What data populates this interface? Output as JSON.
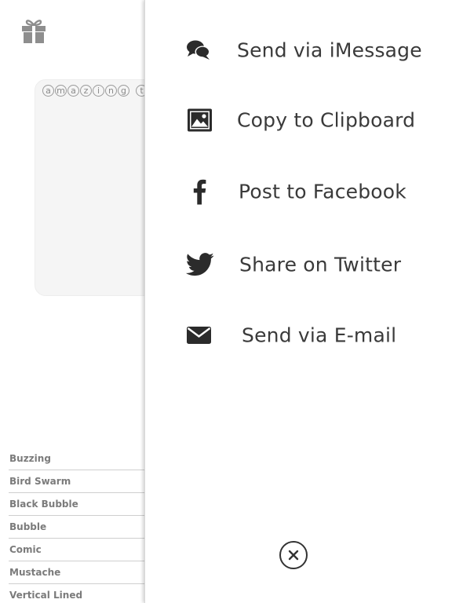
{
  "background": {
    "gift_icon": "gift-icon",
    "preview_chars": [
      "a",
      "m",
      "a",
      "z",
      "i",
      "n",
      "g",
      "t"
    ],
    "style_list": [
      {
        "label": "Buzzing"
      },
      {
        "label": "Bird Swarm"
      },
      {
        "label": "Black Bubble"
      },
      {
        "label": "Bubble"
      },
      {
        "label": "Comic"
      },
      {
        "label": "Mustache"
      },
      {
        "label": "Vertical Lined"
      }
    ]
  },
  "share_sheet": {
    "options": [
      {
        "label": "Send via iMessage",
        "icon": "chat-bubbles-icon"
      },
      {
        "label": "Copy to Clipboard",
        "icon": "image-icon"
      },
      {
        "label": "Post to Facebook",
        "icon": "facebook-icon"
      },
      {
        "label": "Share on Twitter",
        "icon": "twitter-bird-icon"
      },
      {
        "label": "Send via E-mail",
        "icon": "envelope-icon"
      }
    ],
    "close_icon": "close-icon"
  },
  "colors": {
    "icon_dark": "#2b2b2b",
    "label_text": "#3a3a3a",
    "muted_text": "#7b7b7b",
    "card_bg": "#f5f5f5"
  }
}
